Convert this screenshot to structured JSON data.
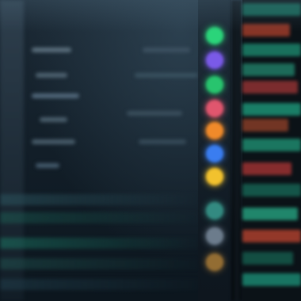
{
  "theme": {
    "background": "#0f1b24",
    "accent_teal": "#1fa587"
  },
  "status_dots": [
    {
      "icon": "green-status-dot-icon",
      "color": "#2bd47a"
    },
    {
      "icon": "purple-status-dot-icon",
      "color": "#7a5ae8"
    },
    {
      "icon": "green-status-dot-icon",
      "color": "#28c46e"
    },
    {
      "icon": "red-status-dot-icon",
      "color": "#e0566e"
    },
    {
      "icon": "orange-status-dot-icon",
      "color": "#f08a2a"
    },
    {
      "icon": "blue-status-dot-icon",
      "color": "#3a7df0"
    },
    {
      "icon": "yellow-status-dot-icon",
      "color": "#f2c22e"
    },
    {
      "icon": "teal-status-dot-icon",
      "color": "#3fb0a0"
    },
    {
      "icon": "gray-status-dot-icon",
      "color": "#8b9db0"
    },
    {
      "icon": "amber-status-dot-icon",
      "color": "#c08a3a"
    }
  ],
  "right_panel_colors": [
    "#1fa587",
    "#c4452e",
    "#1d8a6f",
    "#2cb38f",
    "#b23a3a",
    "#1e9b7c",
    "#c7532f",
    "#23a884",
    "#a83434",
    "#1c8d72",
    "#2bbf95",
    "#b8432f",
    "#1a7f66"
  ]
}
